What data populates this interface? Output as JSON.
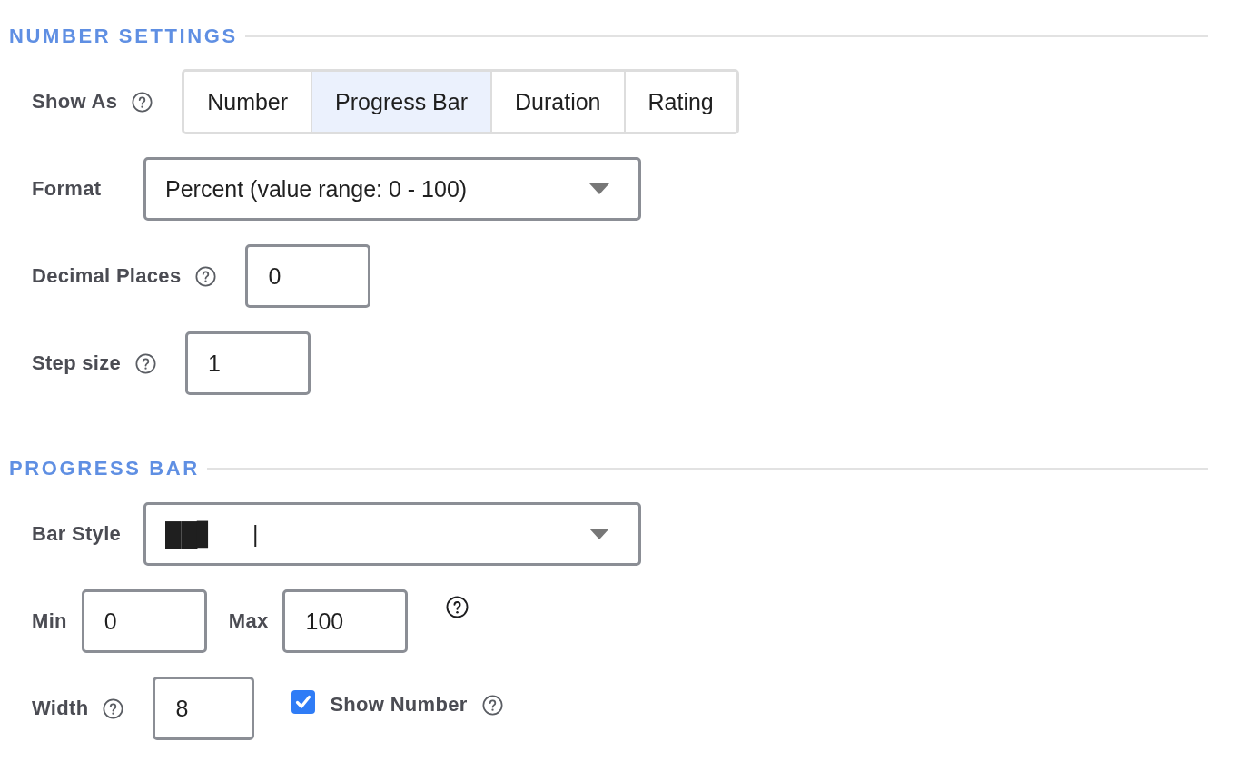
{
  "sections": [
    {
      "title": "NUMBER SETTINGS",
      "rows": [
        {
          "items": [
            {
              "kind": "label",
              "text": "Show As"
            },
            {
              "kind": "help"
            },
            {
              "kind": "segmented",
              "options": [
                {
                  "label": "Number",
                  "selected": false
                },
                {
                  "label": "Progress Bar",
                  "selected": true
                },
                {
                  "label": "Duration",
                  "selected": false
                },
                {
                  "label": "Rating",
                  "selected": false
                }
              ]
            }
          ]
        },
        {
          "items": [
            {
              "kind": "label",
              "text": "Format"
            },
            {
              "kind": "select",
              "value": "Percent (value range: 0 - 100)"
            }
          ]
        },
        {
          "items": [
            {
              "kind": "label",
              "text": "Decimal Places"
            },
            {
              "kind": "help"
            },
            {
              "kind": "input",
              "value": "0"
            }
          ]
        },
        {
          "items": [
            {
              "kind": "label",
              "text": "Step size"
            },
            {
              "kind": "help"
            },
            {
              "kind": "input",
              "value": "1"
            }
          ]
        }
      ]
    },
    {
      "title": "PROGRESS BAR",
      "rows": [
        {
          "items": [
            {
              "kind": "label",
              "text": "Bar Style"
            },
            {
              "kind": "select",
              "value": "██▋      |"
            }
          ]
        },
        {
          "items": [
            {
              "kind": "label",
              "text": "Min"
            },
            {
              "kind": "input",
              "value": "0"
            },
            {
              "kind": "label",
              "text": "Max"
            },
            {
              "kind": "input",
              "value": "100"
            },
            {
              "kind": "help"
            }
          ]
        },
        {
          "items": [
            {
              "kind": "label",
              "text": "Width"
            },
            {
              "kind": "help"
            },
            {
              "kind": "input",
              "value": "8"
            },
            {
              "kind": "checkbox",
              "label": "Show Number",
              "checked": true
            },
            {
              "kind": "help"
            }
          ]
        }
      ]
    }
  ]
}
